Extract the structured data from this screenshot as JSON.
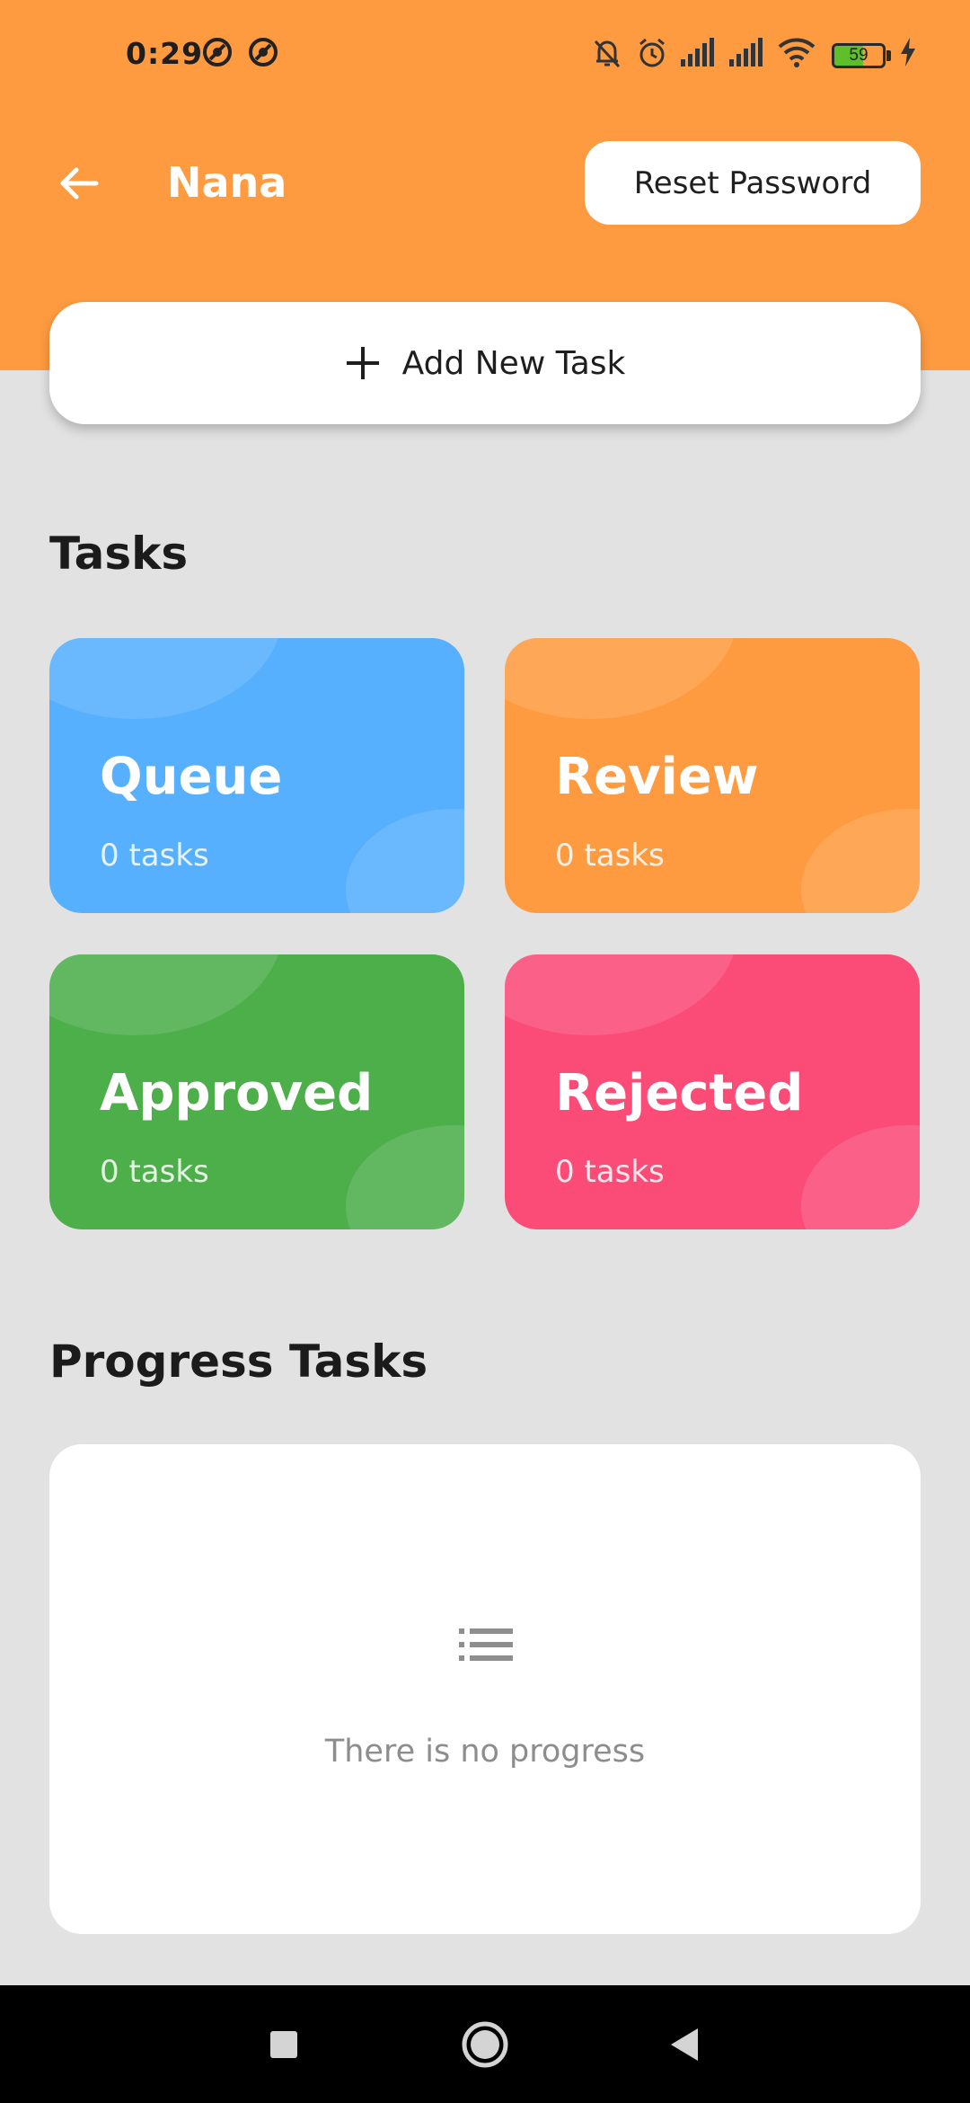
{
  "status_bar": {
    "time": "0:29",
    "battery_level": "59",
    "battery_fraction": 0.59,
    "icons": [
      "no-disturb-icon",
      "no-disturb-icon",
      "bell-off-icon",
      "alarm-icon",
      "signal-icon",
      "signal-icon",
      "wifi-icon",
      "battery-icon",
      "charging-icon"
    ]
  },
  "header": {
    "title": "Nana",
    "reset_label": "Reset Password",
    "add_task_label": "Add New Task",
    "background": "#fe9b40"
  },
  "tasks": {
    "section_title": "Tasks",
    "cards": [
      {
        "title": "Queue",
        "count": "0 tasks",
        "color": "#56b0fe"
      },
      {
        "title": "Review",
        "count": "0 tasks",
        "color": "#fe9b40"
      },
      {
        "title": "Approved",
        "count": "0 tasks",
        "color": "#4caf4a"
      },
      {
        "title": "Rejected",
        "count": "0 tasks",
        "color": "#fb4c78"
      }
    ]
  },
  "progress": {
    "section_title": "Progress Tasks",
    "empty_text": "There is no progress"
  },
  "nav": {
    "icons": [
      "recents-icon",
      "home-icon",
      "back-icon"
    ]
  }
}
